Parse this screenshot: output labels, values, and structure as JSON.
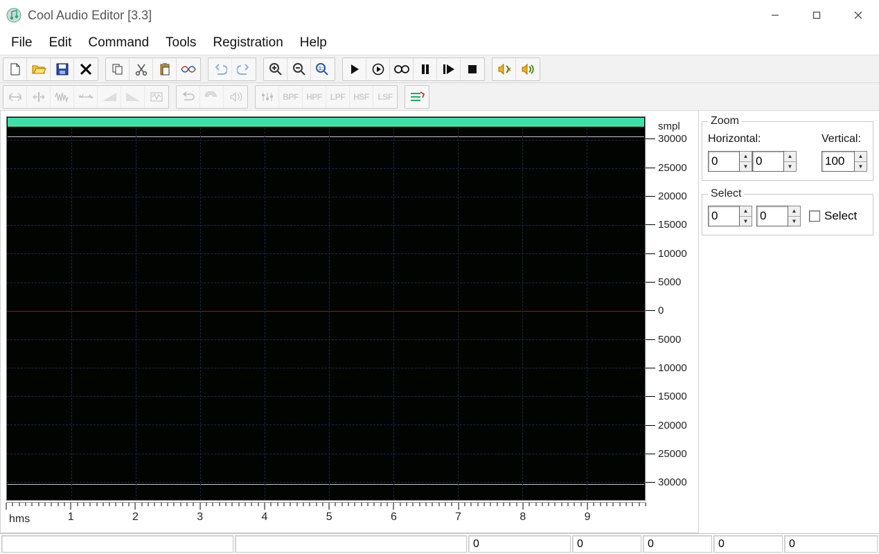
{
  "title": "Cool Audio Editor [3.3]",
  "menu": {
    "file": "File",
    "edit": "Edit",
    "command": "Command",
    "tools": "Tools",
    "registration": "Registration",
    "help": "Help"
  },
  "toolbar1": {
    "new": "new-file-icon",
    "open": "open-file-icon",
    "save": "save-icon",
    "close": "close-icon",
    "copy": "copy-icon",
    "cut": "cut-icon",
    "paste": "paste-icon",
    "mix": "mix-paste-icon",
    "undo": "undo-icon",
    "redo": "redo-icon",
    "zoom_in": "zoom-in-icon",
    "zoom_out": "zoom-out-icon",
    "zoom_sel": "zoom-selection-icon",
    "play": "play-icon",
    "play_loop": "play-loop-icon",
    "loop": "loop-icon",
    "pause": "pause-icon",
    "play_end": "play-to-end-icon",
    "stop": "stop-icon",
    "speaker_left": "speaker-swap-icon",
    "speaker_right": "speaker-icon"
  },
  "toolbar2": {
    "stretch": "stretch-icon",
    "trim": "trim-icon",
    "noise": "noise-icon",
    "silence": "silence-icon",
    "fade_in": "fade-in-icon",
    "fade_out": "fade-out-icon",
    "normalize": "normalize-icon",
    "reverse": "reverse-icon",
    "echo": "echo-icon",
    "amplify": "amplify-icon",
    "eq": "equalizer-icon",
    "bpf": "BPF",
    "hpf": "HPF",
    "lpf": "LPF",
    "hsf": "HSF",
    "lsf": "LSF",
    "effects": "effects-icon"
  },
  "waveform": {
    "y_unit": "smpl",
    "y_ticks": [
      "30000",
      "25000",
      "20000",
      "15000",
      "10000",
      "5000",
      "0",
      "5000",
      "10000",
      "15000",
      "20000",
      "25000",
      "30000"
    ],
    "x_unit": "hms",
    "x_ticks": [
      "1",
      "2",
      "3",
      "4",
      "5",
      "6",
      "7",
      "8",
      "9"
    ]
  },
  "zoom_panel": {
    "legend": "Zoom",
    "horizontal_label": "Horizontal:",
    "vertical_label": "Vertical:",
    "h_start": "0",
    "h_end": "0",
    "v": "100"
  },
  "select_panel": {
    "legend": "Select",
    "start": "0",
    "end": "0",
    "checkbox_label": "Select",
    "checked": false
  },
  "statusbar": {
    "c1": "",
    "c2": "",
    "c3": "0",
    "c4": "0",
    "c5": "0",
    "c6": "0",
    "c7": "0"
  }
}
